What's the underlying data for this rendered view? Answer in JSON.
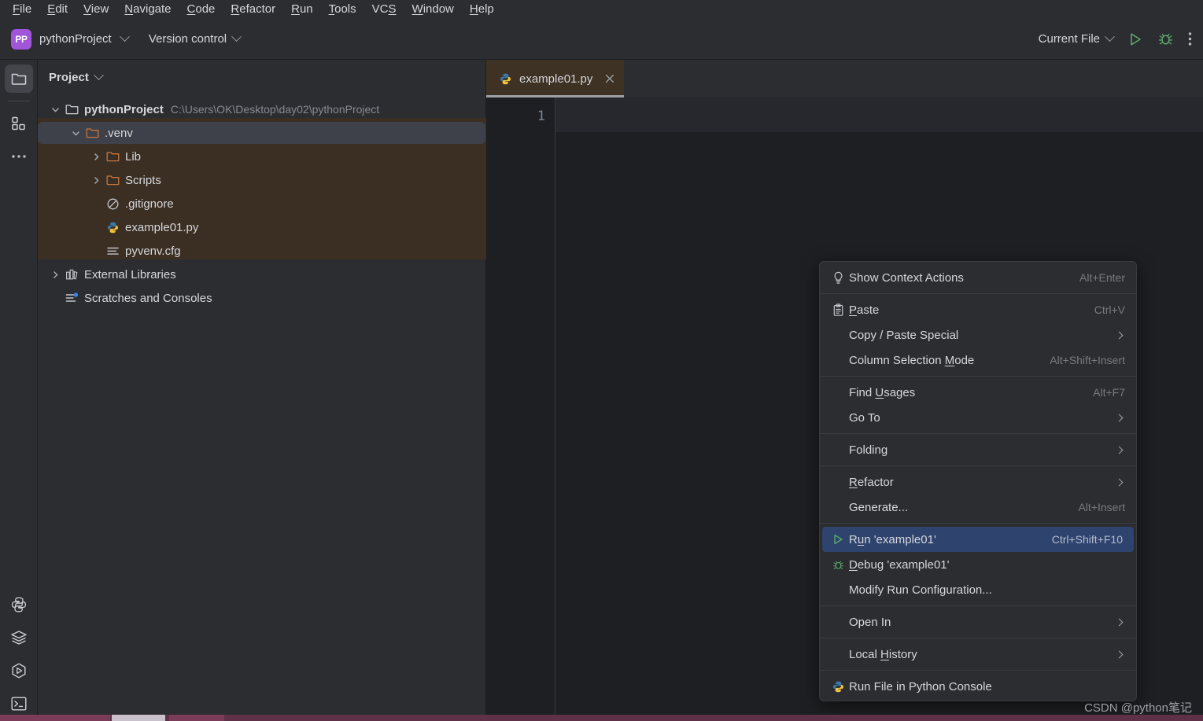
{
  "window": {
    "title": "pythonProject",
    "watermark": "CSDN @python笔记"
  },
  "menubar": {
    "items": [
      {
        "label": "File",
        "mnemonic": "F"
      },
      {
        "label": "Edit",
        "mnemonic": "E"
      },
      {
        "label": "View",
        "mnemonic": "V"
      },
      {
        "label": "Navigate",
        "mnemonic": "N"
      },
      {
        "label": "Code",
        "mnemonic": "C"
      },
      {
        "label": "Refactor",
        "mnemonic": "R"
      },
      {
        "label": "Run",
        "mnemonic": "R"
      },
      {
        "label": "Tools",
        "mnemonic": "T"
      },
      {
        "label": "VCS",
        "mnemonic": "S"
      },
      {
        "label": "Window",
        "mnemonic": "W"
      },
      {
        "label": "Help",
        "mnemonic": "H"
      }
    ]
  },
  "toolbar": {
    "project_badge": "PP",
    "project_name": "pythonProject",
    "version_control": "Version control",
    "run_config": "Current File",
    "run_icon": "run-triangle-icon",
    "debug_icon": "debug-bug-icon",
    "more_icon": "more-vertical-icon",
    "badge_color": "#A155D8",
    "run_color": "#59A869"
  },
  "activity_bar": {
    "top": [
      {
        "name": "project-tool-window",
        "icon": "folder-icon",
        "selected": true
      },
      {
        "name": "structure-tool-window",
        "icon": "structure-blocks-icon",
        "selected": false
      },
      {
        "name": "more-tool-windows",
        "icon": "more-horizontal-icon",
        "selected": false
      }
    ],
    "bottom": [
      {
        "name": "python-console",
        "icon": "python-icon",
        "selected": false
      },
      {
        "name": "python-packages",
        "icon": "layers-icon",
        "selected": false
      },
      {
        "name": "run-tool-window",
        "icon": "run-hexagon-icon",
        "selected": false
      },
      {
        "name": "terminal-tool-window",
        "icon": "terminal-icon",
        "selected": false
      }
    ]
  },
  "project_panel": {
    "title": "Project",
    "tree": [
      {
        "label": "pythonProject",
        "path": "C:\\Users\\OK\\Desktop\\day02\\pythonProject",
        "icon": "folder-icon",
        "depth": 0,
        "expanded": true,
        "bold": true,
        "selected": false,
        "excluded": false
      },
      {
        "label": ".venv",
        "path": "",
        "icon": "folder-orange-icon",
        "depth": 1,
        "expanded": true,
        "bold": false,
        "selected": true,
        "excluded": true
      },
      {
        "label": "Lib",
        "path": "",
        "icon": "folder-orange-icon",
        "depth": 2,
        "expanded": false,
        "bold": false,
        "selected": false,
        "excluded": true
      },
      {
        "label": "Scripts",
        "path": "",
        "icon": "folder-orange-icon",
        "depth": 2,
        "expanded": false,
        "bold": false,
        "selected": false,
        "excluded": true
      },
      {
        "label": ".gitignore",
        "path": "",
        "icon": "gitignore-icon",
        "depth": 2,
        "expanded": null,
        "bold": false,
        "selected": false,
        "excluded": true
      },
      {
        "label": "example01.py",
        "path": "",
        "icon": "python-file-icon",
        "depth": 2,
        "expanded": null,
        "bold": false,
        "selected": false,
        "excluded": true
      },
      {
        "label": "pyvenv.cfg",
        "path": "",
        "icon": "config-file-icon",
        "depth": 2,
        "expanded": null,
        "bold": false,
        "selected": false,
        "excluded": true
      },
      {
        "label": "External Libraries",
        "path": "",
        "icon": "library-icon",
        "depth": 0,
        "expanded": false,
        "bold": false,
        "selected": false,
        "excluded": false
      },
      {
        "label": "Scratches and Consoles",
        "path": "",
        "icon": "scratches-icon",
        "depth": 0,
        "expanded": null,
        "bold": false,
        "selected": false,
        "excluded": false
      }
    ]
  },
  "editor": {
    "tabs": [
      {
        "label": "example01.py",
        "icon": "python-file-icon",
        "active": true,
        "close_icon": "close-icon"
      }
    ],
    "line_numbers": [
      "1"
    ],
    "content": ""
  },
  "context_menu": {
    "items": [
      {
        "label": "Show Context Actions",
        "mnemonic": "",
        "shortcut": "Alt+Enter",
        "icon": "lightbulb-icon",
        "submenu": false,
        "highlighted": false,
        "separator_after": true
      },
      {
        "label": "Paste",
        "mnemonic": "P",
        "shortcut": "Ctrl+V",
        "icon": "clipboard-icon",
        "submenu": false,
        "highlighted": false,
        "separator_after": false
      },
      {
        "label": "Copy / Paste Special",
        "mnemonic": "",
        "shortcut": "",
        "icon": "",
        "submenu": true,
        "highlighted": false,
        "separator_after": false
      },
      {
        "label": "Column Selection Mode",
        "mnemonic": "M",
        "shortcut": "Alt+Shift+Insert",
        "icon": "",
        "submenu": false,
        "highlighted": false,
        "separator_after": true
      },
      {
        "label": "Find Usages",
        "mnemonic": "U",
        "shortcut": "Alt+F7",
        "icon": "",
        "submenu": false,
        "highlighted": false,
        "separator_after": false
      },
      {
        "label": "Go To",
        "mnemonic": "",
        "shortcut": "",
        "icon": "",
        "submenu": true,
        "highlighted": false,
        "separator_after": true
      },
      {
        "label": "Folding",
        "mnemonic": "",
        "shortcut": "",
        "icon": "",
        "submenu": true,
        "highlighted": false,
        "separator_after": true
      },
      {
        "label": "Refactor",
        "mnemonic": "R",
        "shortcut": "",
        "icon": "",
        "submenu": true,
        "highlighted": false,
        "separator_after": false
      },
      {
        "label": "Generate...",
        "mnemonic": "",
        "shortcut": "Alt+Insert",
        "icon": "",
        "submenu": false,
        "highlighted": false,
        "separator_after": true
      },
      {
        "label": "Run 'example01'",
        "mnemonic": "u",
        "shortcut": "Ctrl+Shift+F10",
        "icon": "run-triangle-icon",
        "submenu": false,
        "highlighted": true,
        "separator_after": false
      },
      {
        "label": "Debug 'example01'",
        "mnemonic": "D",
        "shortcut": "",
        "icon": "debug-bug-icon",
        "submenu": false,
        "highlighted": false,
        "separator_after": false
      },
      {
        "label": "Modify Run Configuration...",
        "mnemonic": "",
        "shortcut": "",
        "icon": "",
        "submenu": false,
        "highlighted": false,
        "separator_after": true
      },
      {
        "label": "Open In",
        "mnemonic": "",
        "shortcut": "",
        "icon": "",
        "submenu": true,
        "highlighted": false,
        "separator_after": true
      },
      {
        "label": "Local History",
        "mnemonic": "H",
        "shortcut": "",
        "icon": "",
        "submenu": true,
        "highlighted": false,
        "separator_after": true
      },
      {
        "label": "Run File in Python Console",
        "mnemonic": "",
        "shortcut": "",
        "icon": "python-file-icon",
        "submenu": false,
        "highlighted": false,
        "separator_after": false
      }
    ]
  },
  "colors": {
    "background": "#2B2D30",
    "editor_background": "#1E1F22",
    "excluded_folder": "#3B2F24",
    "selection": "#3E4149",
    "menu_highlight": "#2E436E",
    "accent_green": "#59A869",
    "folder_orange": "#C8763E",
    "taskbar": "#5E3148"
  }
}
